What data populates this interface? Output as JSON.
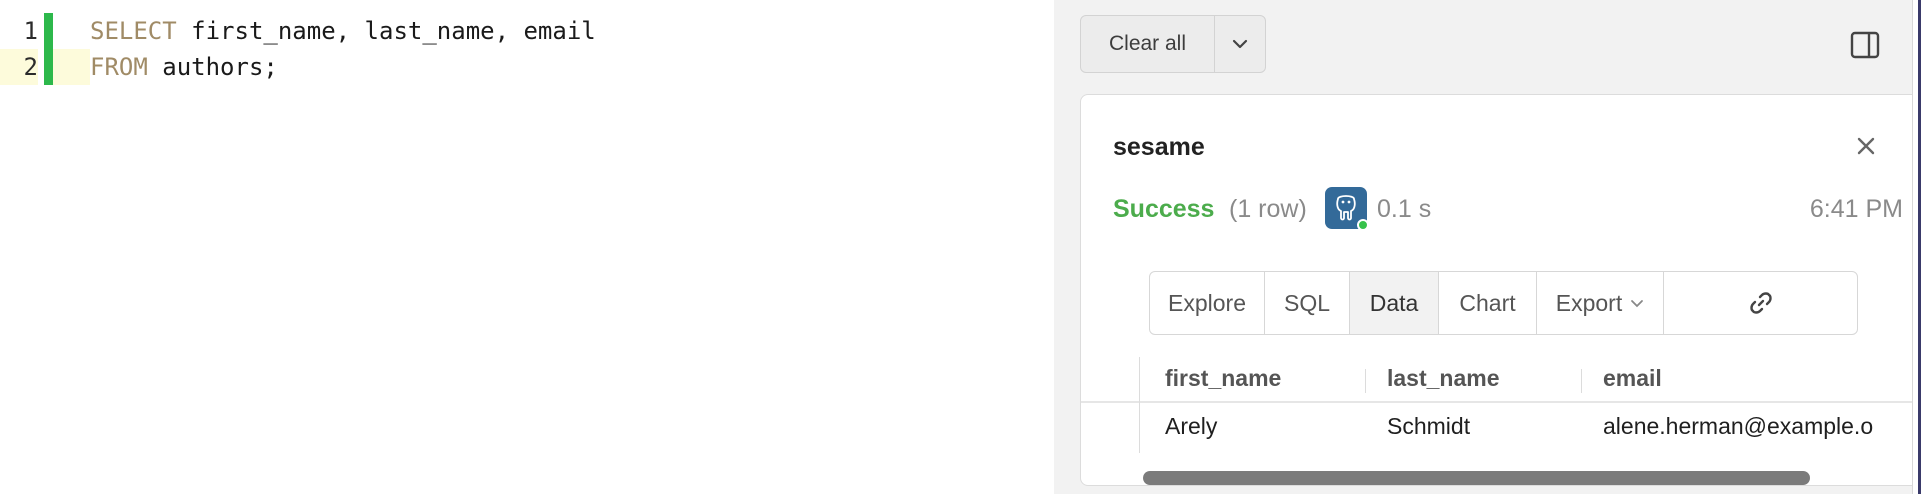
{
  "editor": {
    "lines": [
      {
        "num": "1",
        "kw": "SELECT",
        "rest": " first_name, last_name, email"
      },
      {
        "num": "2",
        "kw": "FROM",
        "rest": " authors;"
      }
    ]
  },
  "toolbar": {
    "clear_label": "Clear all"
  },
  "result": {
    "connection": "sesame",
    "status": "Success",
    "row_count": "(1 row)",
    "duration": "0.1 s",
    "time": "6:41 PM",
    "tabs": [
      {
        "label": "Explore"
      },
      {
        "label": "SQL"
      },
      {
        "label": "Data",
        "active": true
      },
      {
        "label": "Chart"
      },
      {
        "label": "Export"
      }
    ],
    "columns": [
      "first_name",
      "last_name",
      "email"
    ],
    "rows": [
      [
        "Arely",
        "Schmidt",
        "alene.herman@example.o"
      ]
    ]
  },
  "colors": {
    "success": "#4cac4c",
    "gutter_marker": "#2db84b",
    "keyword": "#a08b66",
    "db_icon": "#336a99"
  }
}
